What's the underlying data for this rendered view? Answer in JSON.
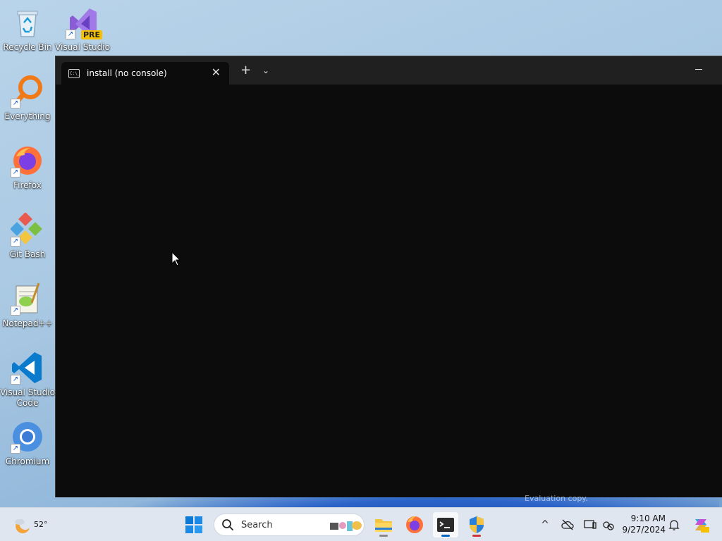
{
  "desktop": {
    "icons": [
      {
        "label": "Recycle Bin"
      },
      {
        "label": "Visual Studio",
        "badge": "PRE"
      },
      {
        "label": "Everything"
      },
      {
        "label": "Firefox"
      },
      {
        "label": "Git Bash"
      },
      {
        "label": "Notepad++"
      },
      {
        "label": "Visual Studio Code"
      },
      {
        "label": "Chromium"
      }
    ],
    "watermark": "Evaluation copy."
  },
  "terminal": {
    "tab_icon_text": "C:\\_",
    "tab_title": "install (no console)",
    "tab_close": "✕",
    "new_tab": "+",
    "dropdown": "⌄"
  },
  "taskbar": {
    "weather_temp": "52°",
    "search_placeholder": "Search",
    "clock_time": "9:10 AM",
    "clock_date": "9/27/2024",
    "tray_chevron": "^"
  },
  "colors": {
    "terminal_bg": "#0c0c0c",
    "titlebar_bg": "#202020",
    "taskbar_bg": "#dfe6ef",
    "accent": "#0067c0"
  }
}
